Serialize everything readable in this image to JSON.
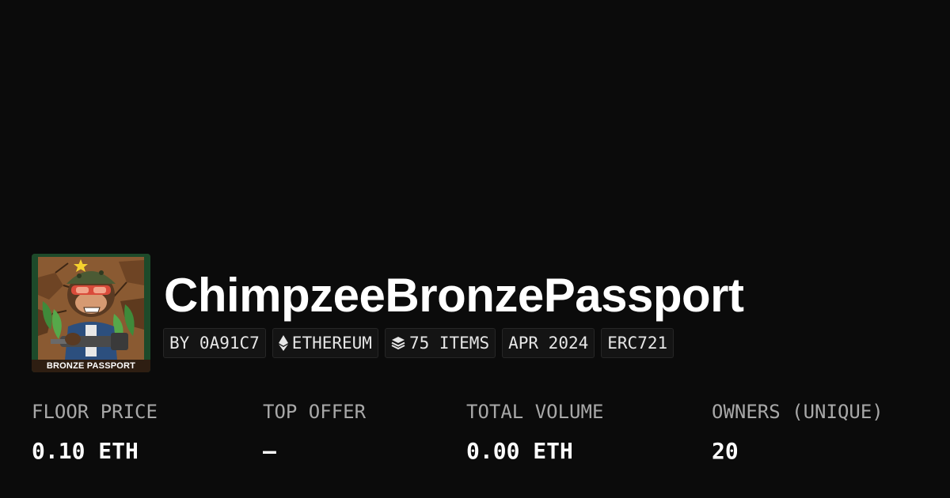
{
  "collection": {
    "name": "ChimpzeeBronzePassport",
    "avatar_caption": "BRONZE PASSPORT"
  },
  "chips": {
    "creator": "BY 0A91C7",
    "chain": "ETHEREUM",
    "chain_icon": "ethereum-icon",
    "items": "75 ITEMS",
    "items_icon": "layers-icon",
    "date": "APR 2024",
    "standard": "ERC721"
  },
  "stats": {
    "floor_label": "FLOOR PRICE",
    "floor_value": "0.10 ETH",
    "offer_label": "TOP OFFER",
    "offer_value": "–",
    "volume_label": "TOTAL VOLUME",
    "volume_value": "0.00 ETH",
    "owners_label": "OWNERS (UNIQUE)",
    "owners_value": "20"
  },
  "colors": {
    "background": "#0b0b0b",
    "text": "#ffffff",
    "muted_text": "#a8a8a8",
    "chip_background": "#141414",
    "chip_border": "#262626"
  }
}
